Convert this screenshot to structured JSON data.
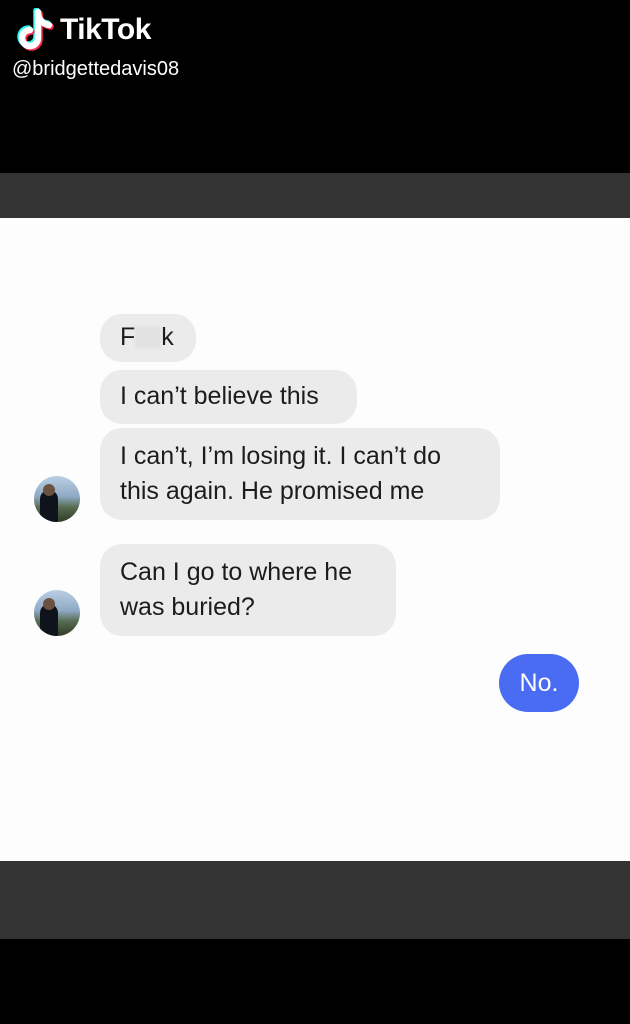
{
  "header": {
    "brand": "TikTok",
    "handle": "@bridgettedavis08",
    "logo_icon": "tiktok-note-icon"
  },
  "chat": {
    "messages": [
      {
        "side": "incoming",
        "pre": "F",
        "post": "k",
        "censored": true
      },
      {
        "side": "incoming",
        "text": "I can’t believe this"
      },
      {
        "side": "incoming",
        "lines": [
          "I can’t, I’m losing it. I can’t do",
          "this again. He promised me"
        ]
      },
      {
        "side": "incoming",
        "lines": [
          "Can I go to where he",
          "was buried?"
        ]
      },
      {
        "side": "outgoing",
        "text": "No."
      }
    ],
    "colors": {
      "incoming_bubble": "#ebebeb",
      "outgoing_bubble": "#4a6cf2",
      "background": "#fdfdfd"
    }
  }
}
